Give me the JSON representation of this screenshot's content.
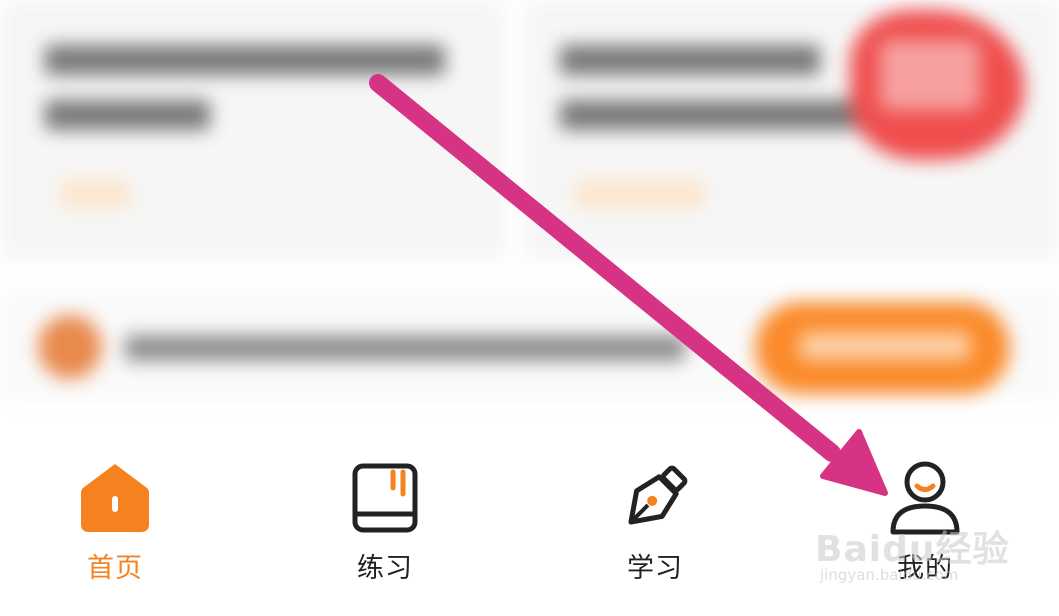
{
  "tabbar": {
    "tabs": [
      {
        "id": "home",
        "label": "首页",
        "icon": "home-icon",
        "active": true
      },
      {
        "id": "practice",
        "label": "练习",
        "icon": "notebook-icon",
        "active": false
      },
      {
        "id": "study",
        "label": "学习",
        "icon": "pen-nib-icon",
        "active": false
      },
      {
        "id": "mine",
        "label": "我的",
        "icon": "person-icon",
        "active": false
      }
    ]
  },
  "annotation": {
    "type": "arrow",
    "color": "#d63384",
    "points_to": "tab-mine"
  },
  "watermark": {
    "main": "Baidu经验",
    "sub": "jingyan.baidu.com"
  },
  "colors": {
    "accent": "#f5821f",
    "text": "#222222",
    "arrow": "#d63384"
  }
}
